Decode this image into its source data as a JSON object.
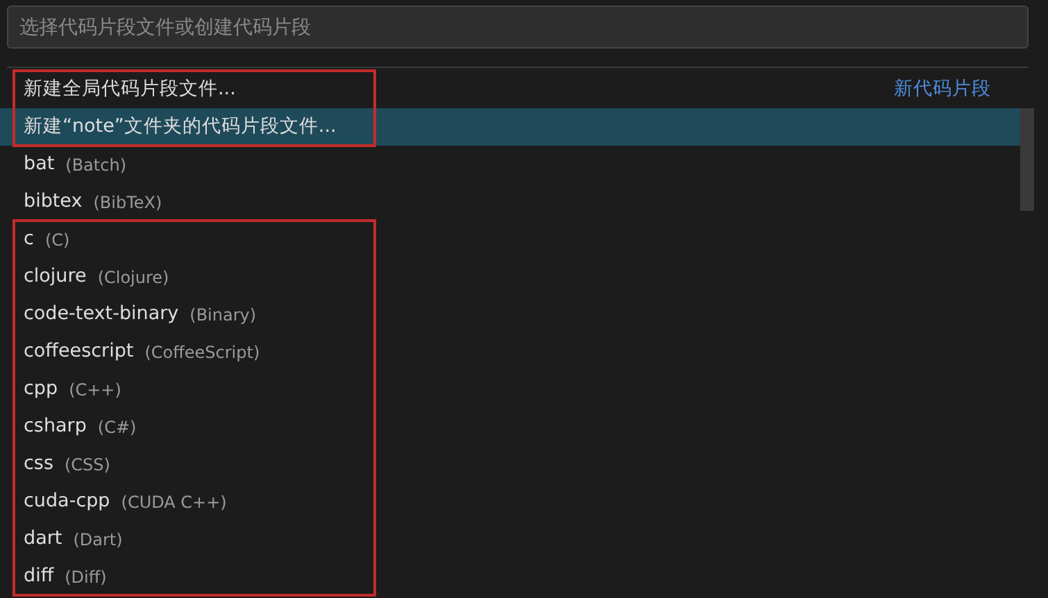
{
  "search": {
    "placeholder": "选择代码片段文件或创建代码片段"
  },
  "groups": [
    {
      "highlighted": true,
      "items": [
        {
          "kind": "command",
          "label": "新建全局代码片段文件...",
          "separator_label": "新代码片段",
          "selected": false
        },
        {
          "kind": "command",
          "label": "新建“note”文件夹的代码片段文件...",
          "selected": true
        }
      ]
    },
    {
      "highlighted": false,
      "items": [
        {
          "kind": "language",
          "label": "bat",
          "description": "(Batch)",
          "selected": false
        },
        {
          "kind": "language",
          "label": "bibtex",
          "description": "(BibTeX)",
          "selected": false
        }
      ]
    },
    {
      "highlighted": true,
      "items": [
        {
          "kind": "language",
          "label": "c",
          "description": "(C)",
          "selected": false
        },
        {
          "kind": "language",
          "label": "clojure",
          "description": "(Clojure)",
          "selected": false
        },
        {
          "kind": "language",
          "label": "code-text-binary",
          "description": "(Binary)",
          "selected": false
        },
        {
          "kind": "language",
          "label": "coffeescript",
          "description": "(CoffeeScript)",
          "selected": false
        },
        {
          "kind": "language",
          "label": "cpp",
          "description": "(C++)",
          "selected": false
        },
        {
          "kind": "language",
          "label": "csharp",
          "description": "(C#)",
          "selected": false
        },
        {
          "kind": "language",
          "label": "css",
          "description": "(CSS)",
          "selected": false
        },
        {
          "kind": "language",
          "label": "cuda-cpp",
          "description": "(CUDA C++)",
          "selected": false
        },
        {
          "kind": "language",
          "label": "dart",
          "description": "(Dart)",
          "selected": false
        },
        {
          "kind": "language",
          "label": "diff",
          "description": "(Diff)",
          "selected": false
        }
      ]
    }
  ]
}
